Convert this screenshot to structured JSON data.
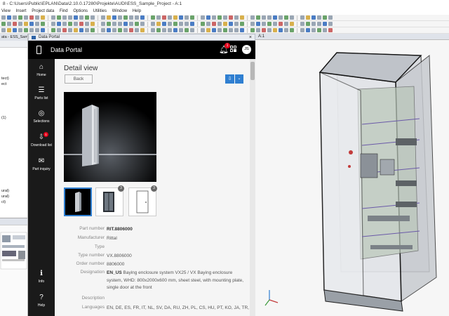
{
  "app": {
    "title": "8 - C:\\Users\\Public\\EPLAN\\Data\\2.10.0.17280\\Projekte\\AUDI\\ESS_Sample_Project - A:1",
    "menu": [
      "View",
      "Insert",
      "Project data",
      "Find",
      "Options",
      "Utilities",
      "Window",
      "Help"
    ]
  },
  "left_panel": {
    "header": "ata - ESS_Sample_",
    "rows": [
      "",
      "",
      "",
      "",
      "",
      "tect)",
      "ect",
      "",
      "",
      "",
      "",
      "",
      "(1)",
      "",
      "",
      "",
      "",
      "",
      "",
      "",
      "",
      "",
      "",
      "",
      "",
      "ural)",
      "ural)",
      "ct)",
      ""
    ]
  },
  "portal": {
    "window_title": "Data Portal",
    "close_glyph": "×",
    "header_title": "Data Portal",
    "notification_count": "1",
    "avatar": "JS",
    "nav": [
      {
        "label": "Home",
        "glyph": "⌂"
      },
      {
        "label": "Parts list",
        "glyph": "☰"
      },
      {
        "label": "Selections",
        "glyph": "◎"
      },
      {
        "label": "Download list",
        "glyph": "⇩",
        "badge": "1"
      },
      {
        "label": "Part inquiry",
        "glyph": "✉"
      },
      {
        "label": "Info",
        "glyph": "ℹ"
      },
      {
        "label": "Help",
        "glyph": "?"
      }
    ],
    "detail": {
      "title": "Detail view",
      "back_label": "Back",
      "download_glyph": "⇩",
      "caret_glyph": "⌄",
      "thumb_badges": [
        "3",
        "3"
      ],
      "properties": [
        {
          "label": "Part number",
          "value": "RIT.8806000",
          "bold": true
        },
        {
          "label": "Manufacturer",
          "value": "Rittal"
        },
        {
          "label": "Type",
          "value": ""
        },
        {
          "label": "Type number",
          "value": "VX.8806000"
        },
        {
          "label": "Order number",
          "value": "8806000"
        },
        {
          "label": "Designation",
          "prefix": "EN_US",
          "value": " Baying enclosure system VX25 / VX Baying enclosure system, WHD: 800x2000x600 mm, sheet steel, with mounting plate, single door at the front"
        },
        {
          "label": "Description",
          "value": ""
        },
        {
          "label": "Languages",
          "value": "EN, DE, ES, FR, IT, NL, SV, DA, RU, ZH, PL, CS, HU, PT, KO, JA, TR, ..."
        }
      ]
    }
  },
  "cad": {
    "tab_label": "A:1"
  },
  "colors": {
    "accent": "#2f7fd1",
    "badge": "#e3001b",
    "header_bg": "#000000",
    "nav_bg": "#1a1a1a"
  }
}
